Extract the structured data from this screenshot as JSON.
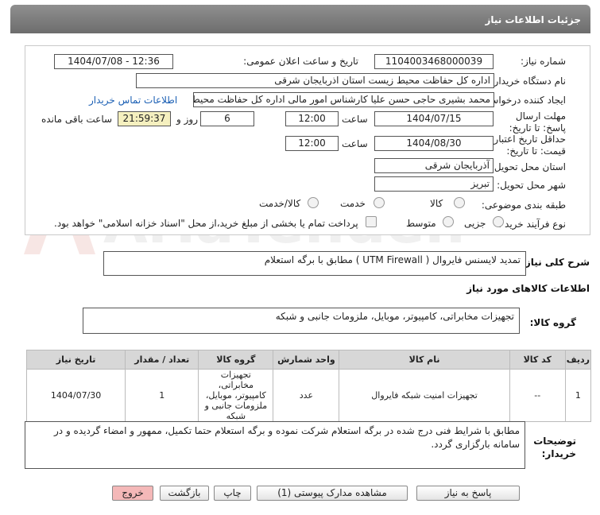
{
  "window": {
    "title": "جزئیات اطلاعات نیاز"
  },
  "fields": {
    "need_number_label": "شماره نیاز:",
    "need_number": "1104003468000039",
    "announce_label": "تاریخ و ساعت اعلان عمومی:",
    "announce_value": "1404/07/08 - 12:36",
    "buyer_org_label": "نام دستگاه خریدار:",
    "buyer_org": "اداره کل حفاظت محیط زیست استان اذربایجان شرقی",
    "creator_label": "ایجاد کننده درخواست:",
    "creator": "محمد بشیری حاجی حسن علیا کارشناس امور مالی اداره کل حفاظت محیط زیست استان اذربایجان شرقی",
    "contact_link": "اطلاعات تماس خریدار",
    "deadline_label": "مهلت ارسال پاسخ: تا تاریخ:",
    "deadline_date": "1404/07/15",
    "time_label": "ساعت",
    "deadline_time": "12:00",
    "days_value": "6",
    "days_label": "روز و",
    "remaining_time": "21:59:37",
    "remaining_label": "ساعت باقی مانده",
    "validity_label": "حداقل تاریخ اعتبار قیمت: تا تاریخ:",
    "validity_date": "1404/08/30",
    "validity_time": "12:00",
    "province_label": "استان محل تحویل:",
    "province": "آذربایجان شرقی",
    "city_label": "شهر محل تحویل:",
    "city": "تبریز",
    "category_label": "طبقه بندی موضوعی:",
    "category_options": [
      "کالا",
      "خدمت",
      "کالا/خدمت"
    ],
    "process_label": "نوع فرآیند خرید :",
    "process_options": [
      "جزیی",
      "متوسط"
    ],
    "payment_note": "پرداخت تمام یا بخشی از مبلغ خرید،از محل \"اسناد خزانه اسلامی\" خواهد بود."
  },
  "summary": {
    "label": "شرح کلی نیاز:",
    "text": "تمدید لایسنس فایروال ( UTM Firewall ) مطابق با برگه استعلام"
  },
  "goods_info": {
    "heading": "اطلاعات کالاهای مورد نیاز",
    "group_label": "گروه کالا:",
    "group_value": "تجهیزات مخابراتی، کامپیوتر، موبایل، ملزومات جانبی و شبکه"
  },
  "table": {
    "headers": [
      "ردیف",
      "کد کالا",
      "نام کالا",
      "واحد شمارش",
      "گروه کالا",
      "تعداد / مقدار",
      "تاریخ نیاز"
    ],
    "rows": [
      [
        "1",
        "--",
        "تجهیزات امنیت شبکه فایروال",
        "عدد",
        "تجهیزات مخابراتی، کامپیوتر، موبایل، ملزومات جانبی و شبکه",
        "1",
        "1404/07/30"
      ]
    ]
  },
  "buyer_notes": {
    "label": "توضیحات خریدار:",
    "text": "مطابق با شرایط فنی درج شده در برگه استعلام شرکت نموده و برگه استعلام حتما تکمیل، ممهور و امضاء گردیده و در سامانه بارگزاری گردد."
  },
  "buttons": {
    "reply": "پاسخ به نیاز",
    "attachments": "مشاهده مدارک پیوستی (1)",
    "print": "چاپ",
    "back": "بازگشت",
    "exit": "خروج"
  },
  "watermark": "AriaTender.neT",
  "colors": {
    "titlebar": "#7a7a7a",
    "link": "#1a5fb4",
    "timer_bg": "#f5f0bf",
    "exit_btn": "#f4b8b8"
  }
}
